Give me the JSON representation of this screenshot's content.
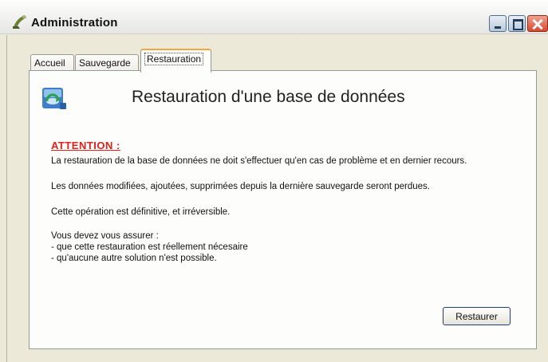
{
  "window": {
    "title": "Administration",
    "icon": "admin-app-icon",
    "controls": [
      "minimize-icon",
      "maximize-icon",
      "close-icon"
    ]
  },
  "tabs": [
    {
      "label": "Accueil",
      "selected": false
    },
    {
      "label": "Sauvegarde",
      "selected": false
    },
    {
      "label": "Restauration",
      "selected": true
    }
  ],
  "panel": {
    "icon": "database-restore-icon",
    "title": "Restauration d'une base de données",
    "warning_label": "ATTENTION :",
    "paragraphs": [
      "La restauration de la base de données ne doit s'effectuer qu'en cas de problème et en dernier recours.",
      "Les données modifiées, ajoutées, supprimées depuis la dernière sauvegarde seront perdues.",
      "Cette opération est définitive, et irréversible."
    ],
    "notice_intro": "Vous devez vous assurer :",
    "conditions": [
      "- que cette restauration est réellement nécesaire",
      "- qu'aucune autre solution n'est possible."
    ],
    "restore_button": "Restaurer"
  },
  "colors": {
    "warning": "#e0201a",
    "active_tab_accent": "#f2a73c",
    "button_border": "#1f3f7a"
  }
}
